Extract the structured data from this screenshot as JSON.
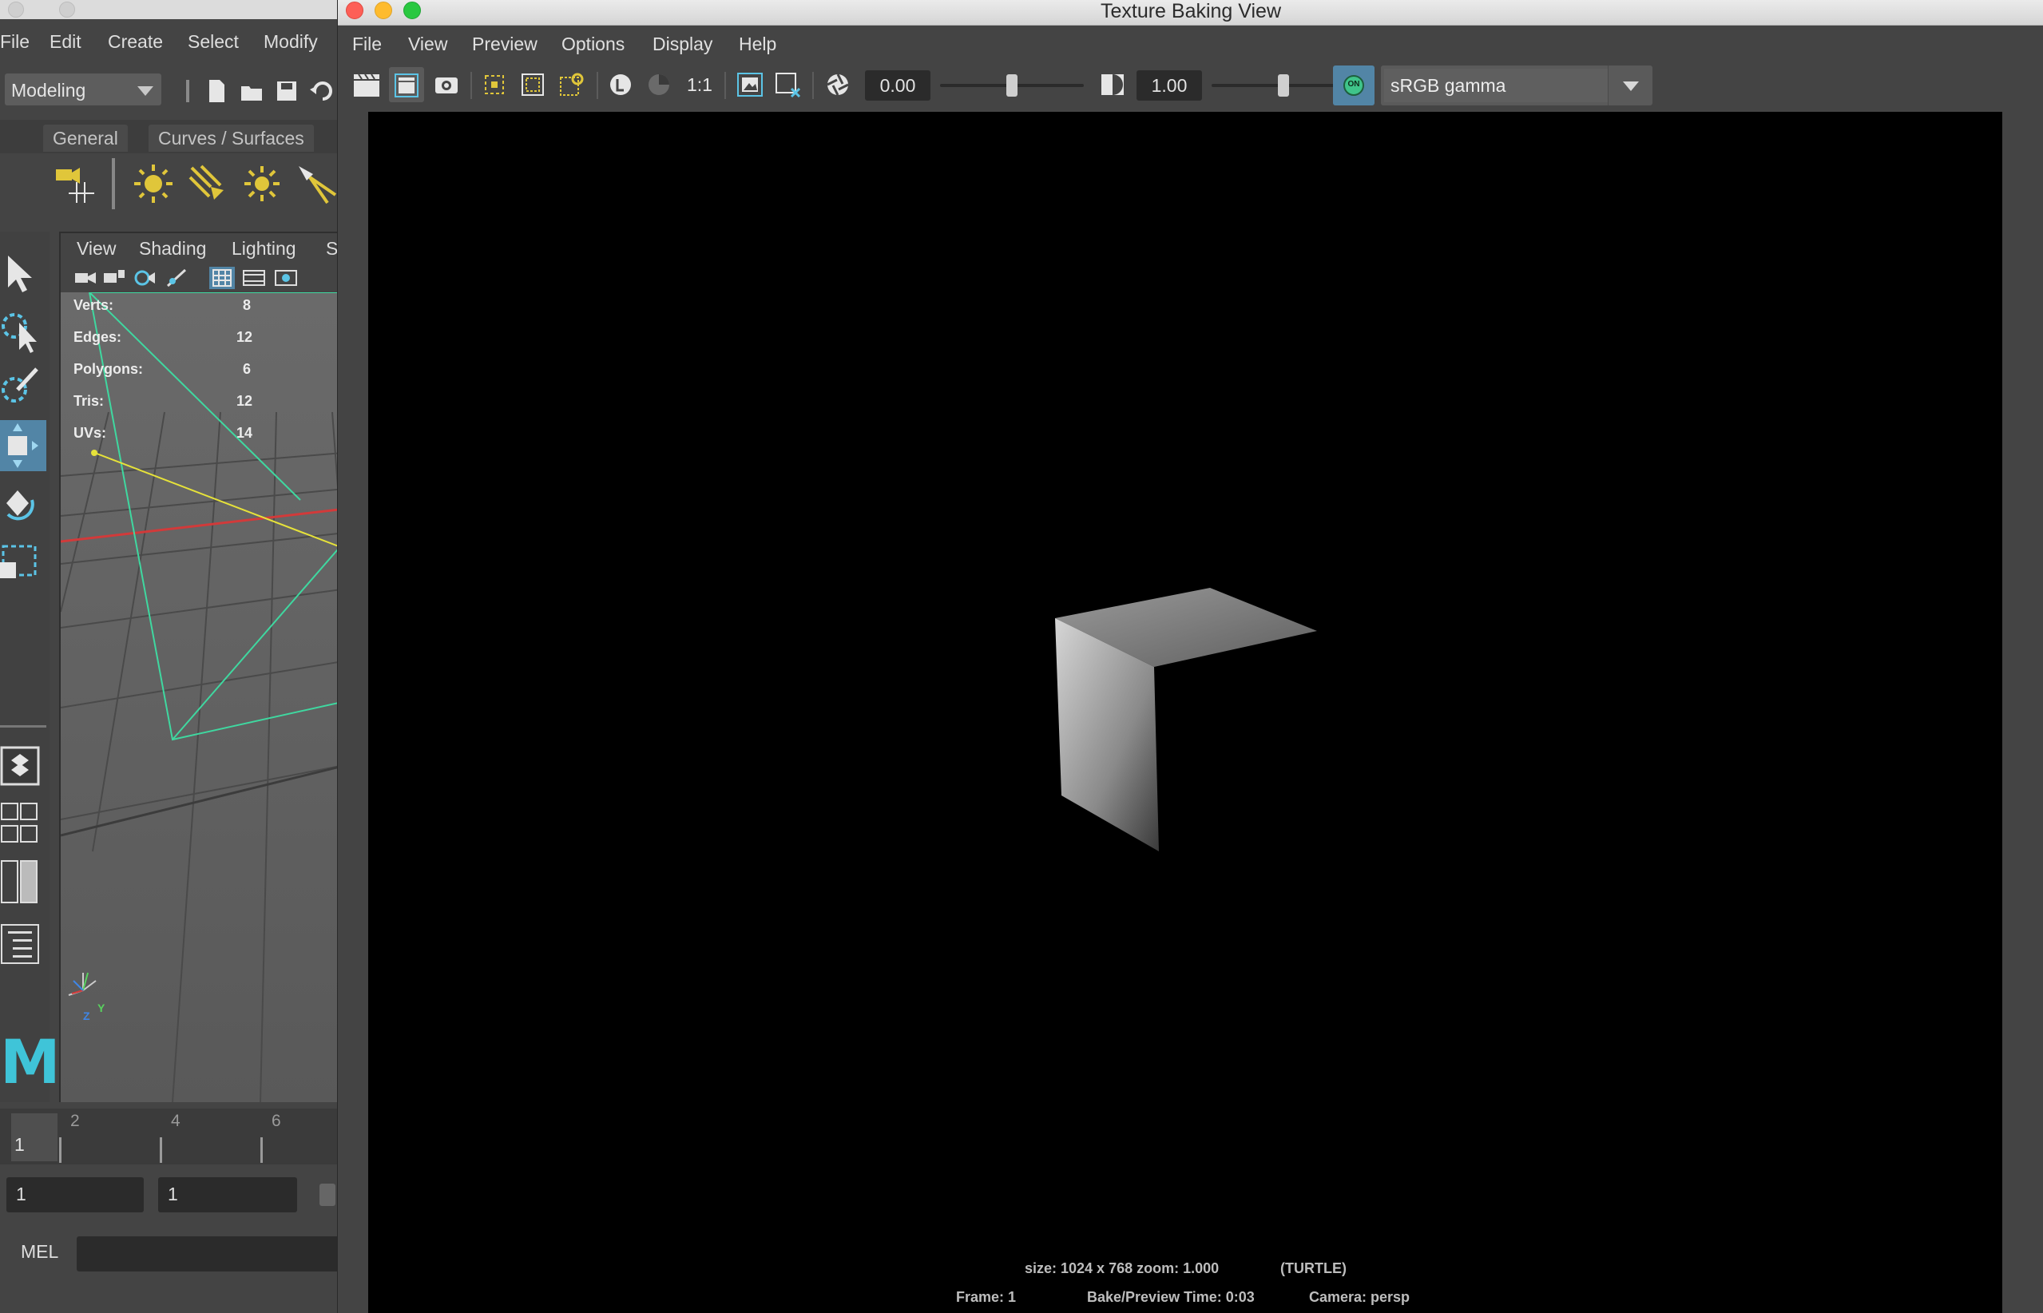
{
  "main_window": {
    "menus": [
      "File",
      "Edit",
      "Create",
      "Select",
      "Modify"
    ],
    "mode": "Modeling",
    "shelf_tabs": [
      "General",
      "Curves / Surfaces"
    ],
    "viewport": {
      "menus": [
        "View",
        "Shading",
        "Lighting",
        "S"
      ],
      "hud": [
        {
          "label": "Verts:",
          "value": "8"
        },
        {
          "label": "Edges:",
          "value": "12"
        },
        {
          "label": "Polygons:",
          "value": "6"
        },
        {
          "label": "Tris:",
          "value": "12"
        },
        {
          "label": "UVs:",
          "value": "14"
        }
      ],
      "axis_labels": {
        "y": "Y",
        "z": "Z"
      }
    },
    "timeline": {
      "ticks": [
        "2",
        "4",
        "6"
      ],
      "current": "1"
    },
    "range": {
      "start": "1",
      "end": "1"
    },
    "cmd_label": "MEL",
    "logo": "M"
  },
  "tbv": {
    "title": "Texture Baking View",
    "menus": [
      "File",
      "View",
      "Preview",
      "Options",
      "Display",
      "Help"
    ],
    "toolbar": {
      "ratio_label": "1:1",
      "exposure_value": "0.00",
      "gamma_value": "1.00",
      "gamma_toggle": "ON",
      "color_space": "sRGB gamma",
      "exposure_slider_level": 0.5,
      "gamma_slider_level": 0.5
    },
    "info": {
      "size": "size: 1024 x 768 zoom: 1.000",
      "renderer": "(TURTLE)",
      "frame": "Frame: 1",
      "time": "Bake/Preview Time: 0:03",
      "camera": "Camera: persp"
    }
  },
  "colors": {
    "accent": "#5285a6",
    "wire_green": "#3fd8a0",
    "wire_yellow": "#e6e23a",
    "icon_yellow": "#e0c63a"
  }
}
